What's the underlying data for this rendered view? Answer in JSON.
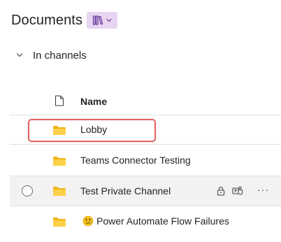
{
  "header": {
    "title": "Documents",
    "view_icon": "library-icon"
  },
  "section": {
    "label": "In channels",
    "icon": "chevron-down-icon"
  },
  "columns": {
    "name": "Name",
    "type_icon": "document-icon"
  },
  "rows": [
    {
      "name": "Lobby",
      "icon": "folder-icon",
      "highlighted": true
    },
    {
      "name": "Teams Connector Testing",
      "icon": "folder-icon"
    },
    {
      "name": "Test Private Channel",
      "icon": "folder-icon",
      "private": true,
      "actions": [
        "lock-icon",
        "teams-icon",
        "more-icon"
      ],
      "more_label": "···"
    },
    {
      "name": "Power Automate Flow Failures",
      "icon": "folder-icon",
      "emoji": "disappointed-relieved-face-icon"
    }
  ],
  "colors": {
    "folder": "#f7c21a",
    "accent": "#e8d5f2",
    "highlight": "#e06565",
    "hover_row": "#f3f2f1"
  }
}
